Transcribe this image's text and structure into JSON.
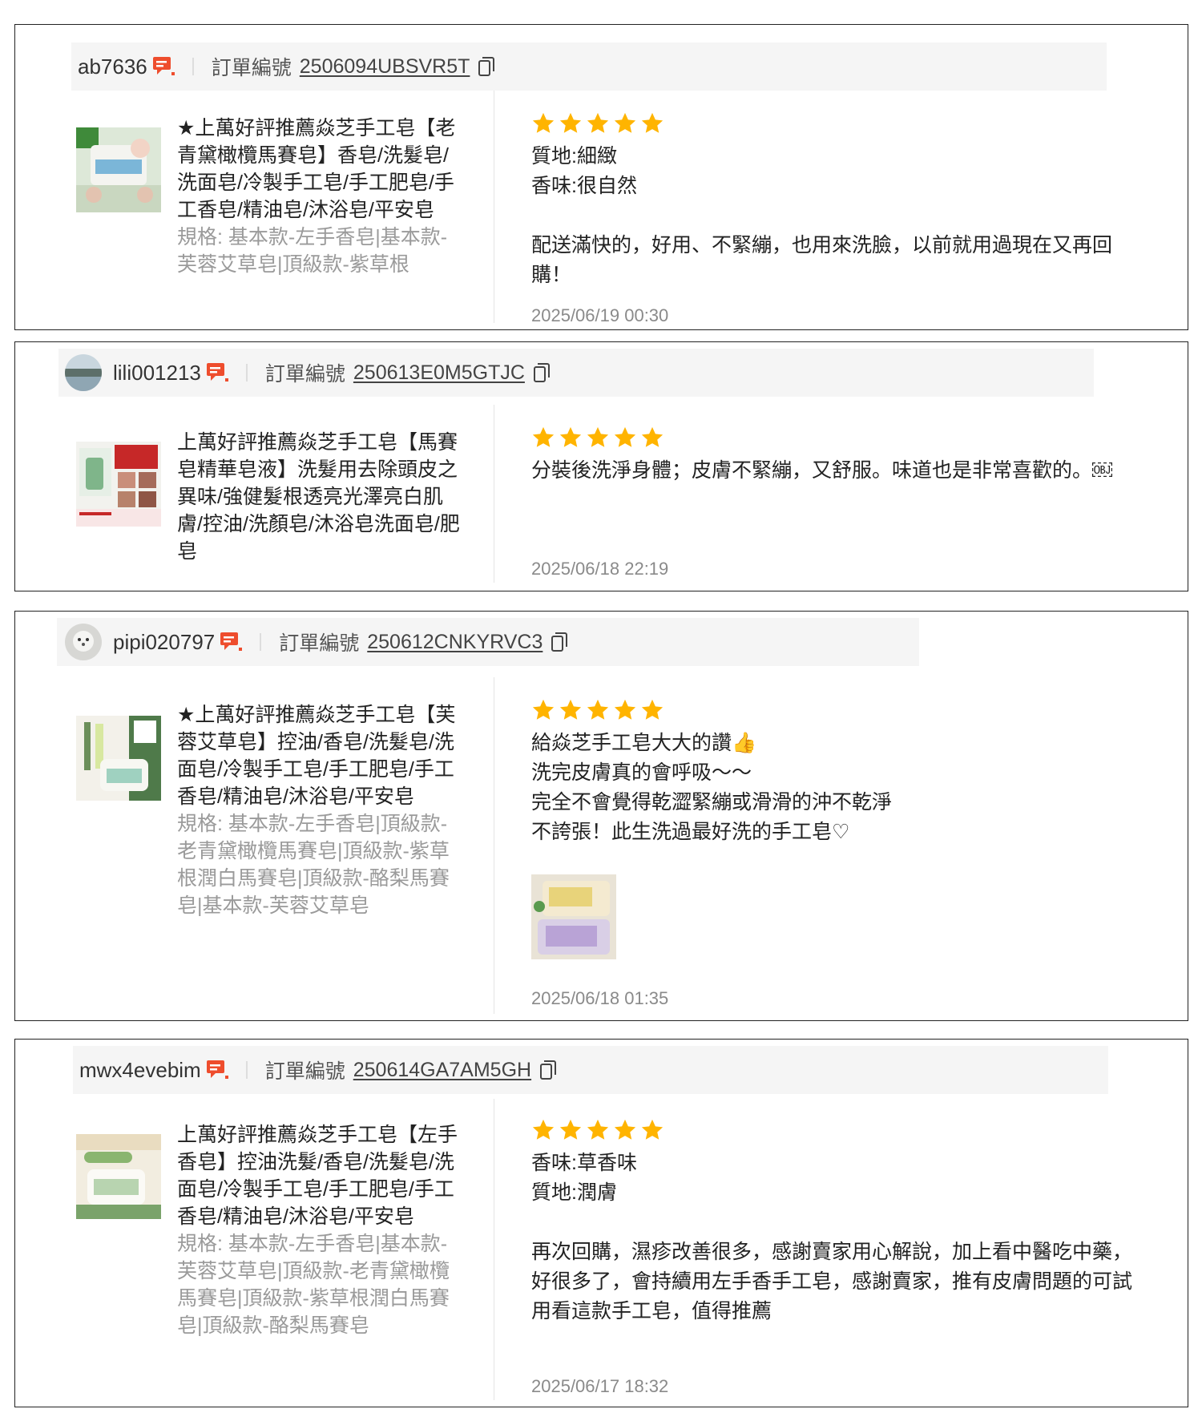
{
  "colors": {
    "chat_icon": "#ee4d2d",
    "star": "#ffb400",
    "variant_text": "#9a9a9a"
  },
  "order_label": "訂單編號",
  "reviews": [
    {
      "username": "ab7636",
      "order_number": "2506094UBSVR5T",
      "product_name": "★上萬好評推薦焱芝手工皂【老青黛橄欖馬賽皂】香皂/洗髮皂/洗面皂/冷製手工皂/手工肥皂/手工香皂/精油皂/沐浴皂/平安皂",
      "variant": "規格: 基本款-左手香皂|基本款-芙蓉艾草皂|頂級款-紫草根",
      "rating": 5,
      "lines": [
        "質地:細緻",
        "香味:很自然",
        "",
        "配送滿快的，好用、不緊繃，也用來洗臉，以前就用過現在又再回購！"
      ],
      "date": "2025/06/19 00:30"
    },
    {
      "username": "lili001213",
      "order_number": "250613E0M5GTJC",
      "product_name": "上萬好評推薦焱芝手工皂【馬賽皂精華皂液】洗髮用去除頭皮之異味/強健髮根透亮光澤亮白肌膚/控油/洗顏皂/沐浴皂洗面皂/肥皂",
      "variant": "",
      "rating": 5,
      "lines": [
        "分裝後洗淨身體；皮膚不緊繃，又舒服。味道也是非常喜歡的。￼"
      ],
      "date": "2025/06/18 22:19"
    },
    {
      "username": "pipi020797",
      "order_number": "250612CNKYRVC3",
      "product_name": "★上萬好評推薦焱芝手工皂【芙蓉艾草皂】控油/香皂/洗髮皂/洗面皂/冷製手工皂/手工肥皂/手工香皂/精油皂/沐浴皂/平安皂",
      "variant": "規格: 基本款-左手香皂|頂級款-老青黛橄欖馬賽皂|頂級款-紫草根潤白馬賽皂|頂級款-酪梨馬賽皂|基本款-芙蓉艾草皂",
      "rating": 5,
      "lines": [
        "給焱芝手工皂大大的讚👍",
        "洗完皮膚真的會呼吸～～",
        "完全不會覺得乾澀緊繃或滑滑的沖不乾淨",
        "不誇張！此生洗過最好洗的手工皂♡"
      ],
      "date": "2025/06/18 01:35"
    },
    {
      "username": "mwx4evebim",
      "order_number": "250614GA7AM5GH",
      "product_name": "上萬好評推薦焱芝手工皂【左手香皂】控油洗髮/香皂/洗髮皂/洗面皂/冷製手工皂/手工肥皂/手工香皂/精油皂/沐浴皂/平安皂",
      "variant": "規格: 基本款-左手香皂|基本款-芙蓉艾草皂|頂級款-老青黛橄欖馬賽皂|頂級款-紫草根潤白馬賽皂|頂級款-酪梨馬賽皂",
      "rating": 5,
      "lines": [
        "香味:草香味",
        "質地:潤膚",
        "",
        "再次回購，濕疹改善很多，感謝賣家用心解說，加上看中醫吃中藥，好很多了，會持續用左手香手工皂，感謝賣家，推有皮膚問題的可試用看這款手工皂，值得推薦"
      ],
      "date": "2025/06/17 18:32"
    }
  ]
}
